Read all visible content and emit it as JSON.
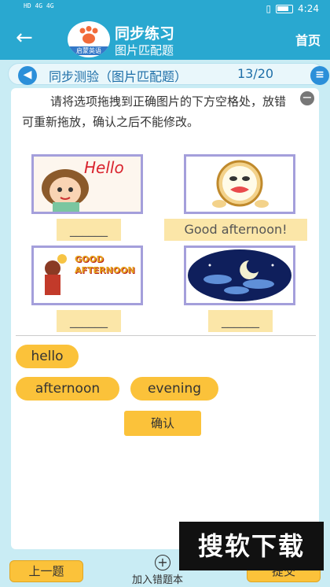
{
  "status_bar": {
    "left_indicators": "HD 4G 4G",
    "time": "4:24"
  },
  "header": {
    "back_icon": "back-arrow-icon",
    "logo_tag": "启蒙英语",
    "title": "同步练习",
    "subtitle": "图片匹配题",
    "home_label": "首页"
  },
  "test_bar": {
    "title": "同步测验（图片匹配题）",
    "counter": "13/20"
  },
  "question": {
    "instruction": "请将选项拖拽到正确图片的下方空格处，放错可重新拖放，确认之后不能修改。",
    "pictures": [
      {
        "name": "hello-girl",
        "caption": "Hello"
      },
      {
        "name": "clock-tired",
        "caption": ""
      },
      {
        "name": "good-afternoon-dog",
        "caption": "GOOD AFTERNOON"
      },
      {
        "name": "night-sky",
        "caption": ""
      }
    ],
    "slots": [
      "______",
      "Good afternoon!",
      "______",
      "______"
    ]
  },
  "options": {
    "items": [
      "hello",
      "afternoon",
      "evening"
    ]
  },
  "confirm_label": "确认",
  "bottom": {
    "prev_label": "上一题",
    "add_label": "加入错题本",
    "next_label": "提交"
  },
  "watermark": "搜软下载",
  "colors": {
    "primary": "#29a8d0",
    "accent": "#fbc23a",
    "slot": "#fbe6a8",
    "frame": "#a49fdb"
  }
}
